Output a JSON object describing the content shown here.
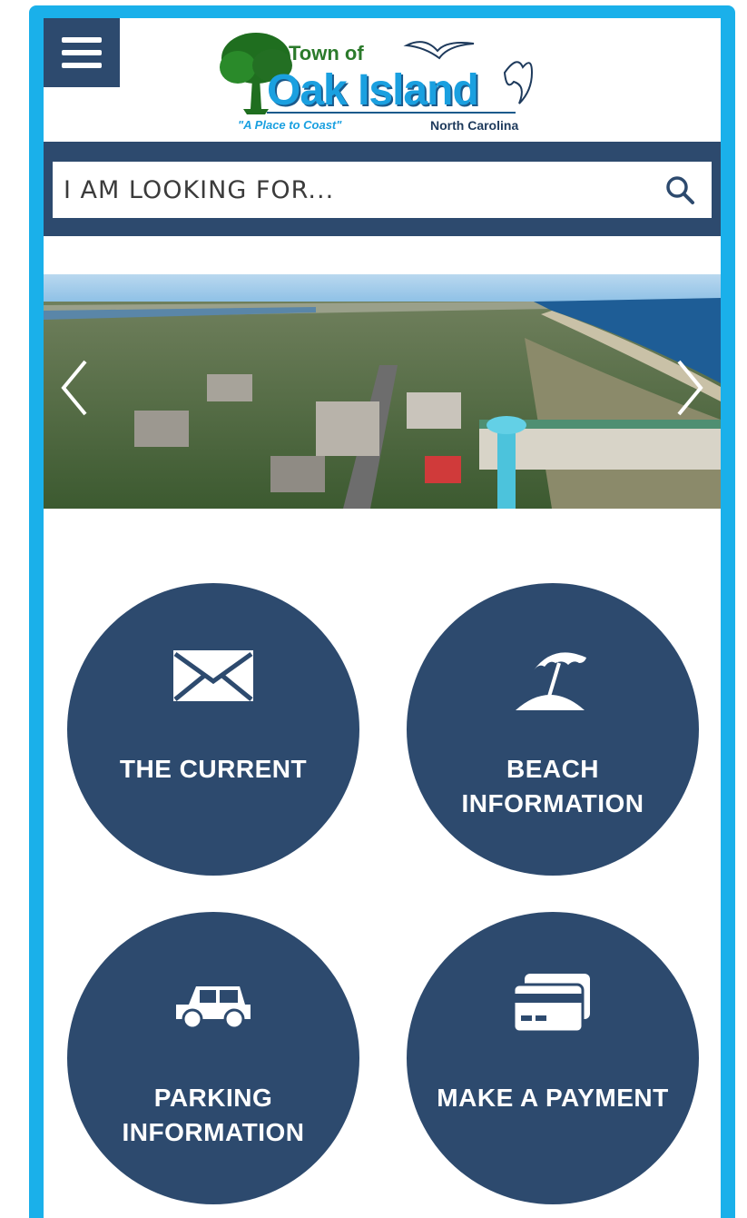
{
  "header": {
    "menu_label": "",
    "logo": {
      "title_line": "Town of",
      "name": "Oak Island",
      "tagline": "\"A Place to Coast\"",
      "state": "North Carolina"
    }
  },
  "search": {
    "placeholder": "I AM LOOKING FOR..."
  },
  "slideshow": {
    "prev_icon": "chevron-left-icon",
    "next_icon": "chevron-right-icon"
  },
  "quick_links": [
    {
      "label": "THE CURRENT",
      "icon": "envelope-icon"
    },
    {
      "label": "BEACH INFORMATION",
      "icon": "beach-umbrella-icon"
    },
    {
      "label": "PARKING INFORMATION",
      "icon": "car-icon"
    },
    {
      "label": "MAKE A PAYMENT",
      "icon": "credit-card-icon"
    }
  ],
  "colors": {
    "frame": "#1ab0ea",
    "navy": "#2d4a6e",
    "logo_blue": "#1aa0e0",
    "logo_green": "#2b7a2b"
  }
}
